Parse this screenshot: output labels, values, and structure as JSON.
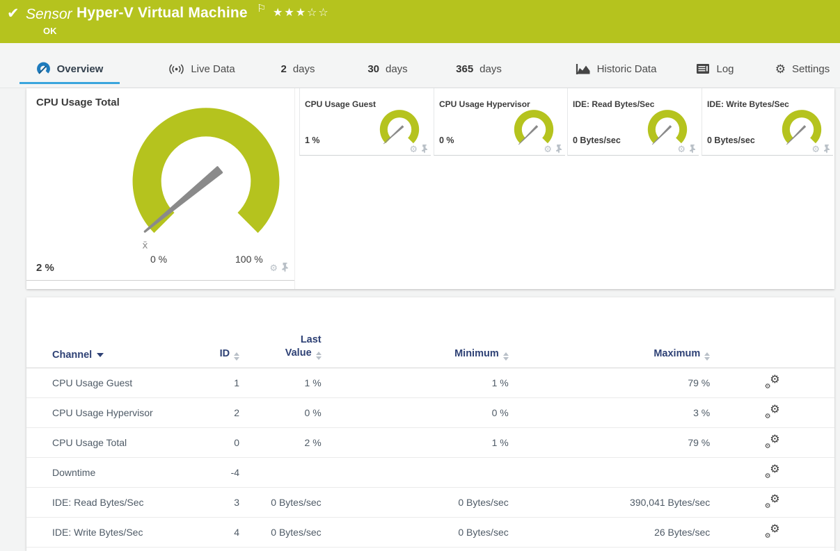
{
  "header": {
    "check": "✔",
    "kind": "Sensor",
    "title": "Hyper-V Virtual Machine",
    "flag": "⚐",
    "stars": "★★★☆☆",
    "status": "OK"
  },
  "tabs": {
    "overview": "Overview",
    "live_data": "Live Data",
    "d2_num": "2",
    "d2_label": "days",
    "d30_num": "30",
    "d30_label": "days",
    "d365_num": "365",
    "d365_label": "days",
    "historic": "Historic Data",
    "log": "Log",
    "settings": "Settings",
    "settings_gear": "⚙"
  },
  "tiles": {
    "gauge_color": "#b5c31e",
    "needle_color": "#8a8a8a",
    "main": {
      "title": "CPU Usage Total",
      "value": "2 %",
      "percent": 2,
      "scale_min": "0 %",
      "scale_max": "100 %",
      "avg_marker": "x̄"
    },
    "small": [
      {
        "title": "CPU Usage Guest",
        "value": "1 %",
        "percent": 1
      },
      {
        "title": "CPU Usage Hypervisor",
        "value": "0 %",
        "percent": 0
      },
      {
        "title": "IDE: Read Bytes/Sec",
        "value": "0 Bytes/sec",
        "percent": 0
      },
      {
        "title": "IDE: Write Bytes/Sec",
        "value": "0 Bytes/sec",
        "percent": 0
      }
    ],
    "tool_gear": "⚙"
  },
  "table": {
    "headers": {
      "channel": "Channel",
      "id": "ID",
      "last_line1": "Last",
      "last_line2": "Value",
      "minimum": "Minimum",
      "maximum": "Maximum"
    },
    "row_gear": "⚙",
    "rows": [
      {
        "channel": "CPU Usage Guest",
        "id": "1",
        "last": "1 %",
        "min": "1 %",
        "max": "79 %"
      },
      {
        "channel": "CPU Usage Hypervisor",
        "id": "2",
        "last": "0 %",
        "min": "0 %",
        "max": "3 %"
      },
      {
        "channel": "CPU Usage Total",
        "id": "0",
        "last": "2 %",
        "min": "1 %",
        "max": "79 %"
      },
      {
        "channel": "Downtime",
        "id": "-4",
        "last": "",
        "min": "",
        "max": ""
      },
      {
        "channel": "IDE: Read Bytes/Sec",
        "id": "3",
        "last": "0 Bytes/sec",
        "min": "0 Bytes/sec",
        "max": "390,041 Bytes/sec"
      },
      {
        "channel": "IDE: Write Bytes/Sec",
        "id": "4",
        "last": "0 Bytes/sec",
        "min": "0 Bytes/sec",
        "max": "26 Bytes/sec"
      }
    ]
  },
  "colors": {
    "brand_green": "#b5c31e",
    "accent_blue": "#3aa5dd",
    "header_navy": "#2e4175"
  }
}
